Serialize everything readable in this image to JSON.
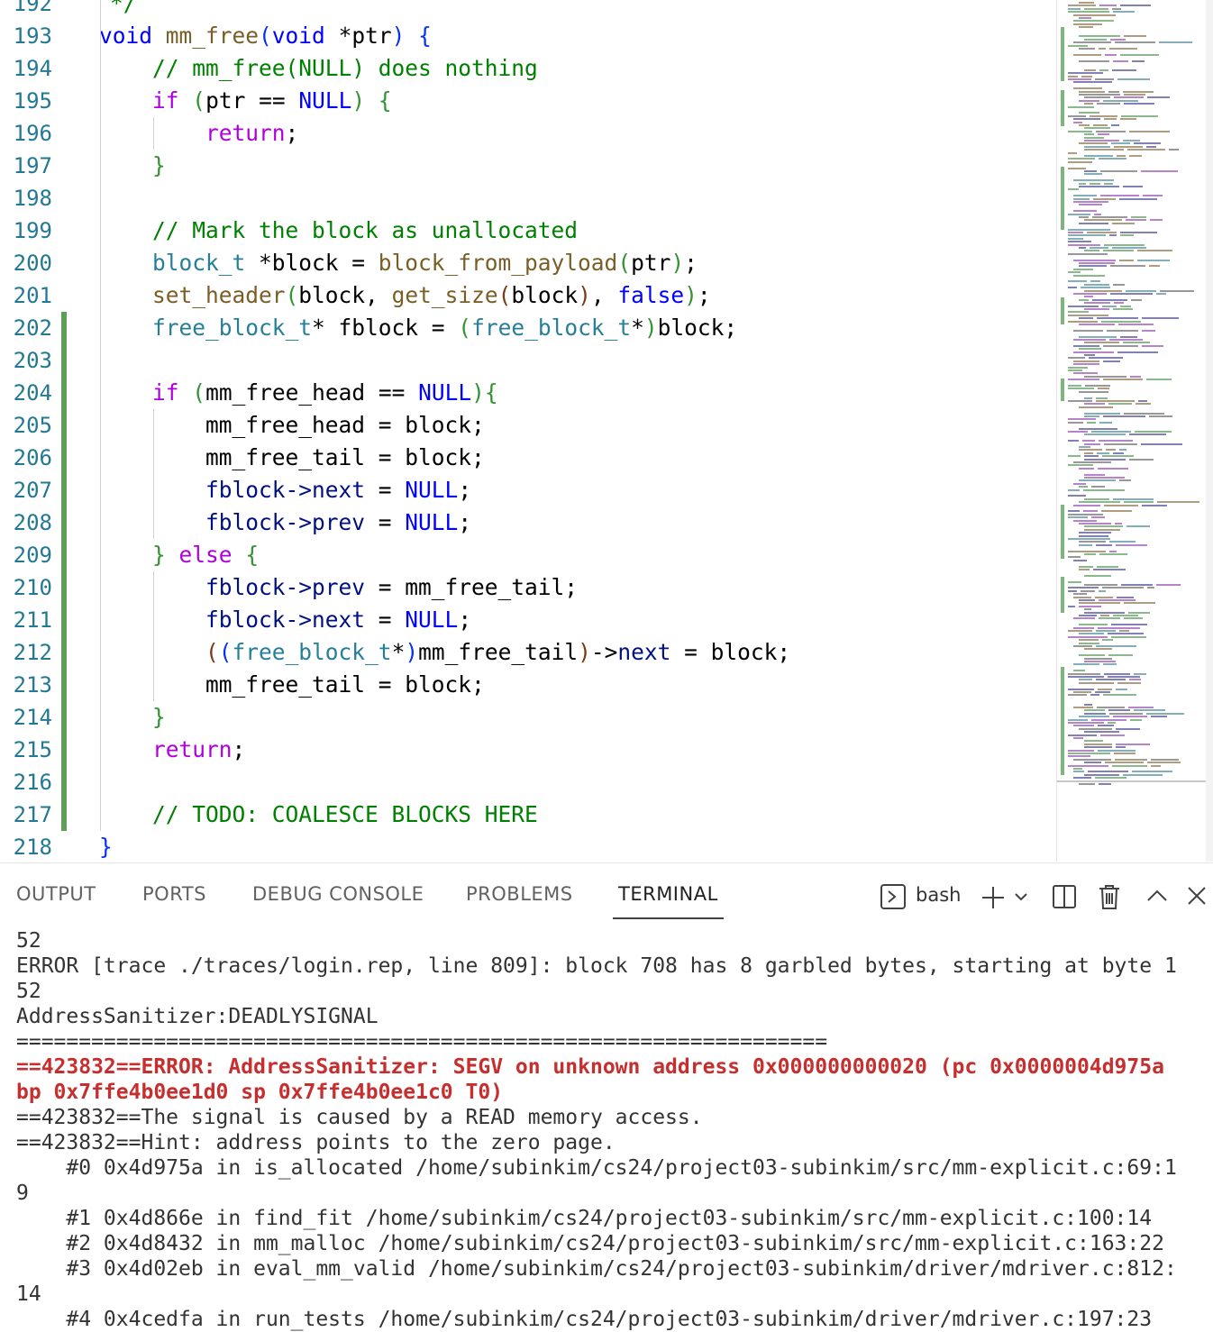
{
  "editor": {
    "partial_top_line": {
      "number": "192",
      "text": "*/"
    },
    "lines": [
      {
        "n": "193",
        "tokens": [
          [
            "kw",
            "void"
          ],
          [
            "",
            ""
          ],
          [
            "fn",
            " mm_free"
          ],
          [
            "p1",
            "("
          ],
          [
            "kw",
            "void"
          ],
          [
            "",
            " *ptr"
          ],
          [
            "p1",
            ")"
          ],
          [
            "",
            " "
          ],
          [
            "p1",
            "{"
          ]
        ]
      },
      {
        "n": "194",
        "tokens": [
          [
            "",
            "    "
          ],
          [
            "cm",
            "// mm_free(NULL) does nothing"
          ]
        ]
      },
      {
        "n": "195",
        "tokens": [
          [
            "",
            "    "
          ],
          [
            "ctl",
            "if"
          ],
          [
            "",
            " "
          ],
          [
            "p2",
            "("
          ],
          [
            "",
            "ptr == "
          ],
          [
            "nl",
            "NULL"
          ],
          [
            "p2",
            ")"
          ],
          [
            "",
            " "
          ],
          [
            "p2",
            "{"
          ]
        ]
      },
      {
        "n": "196",
        "tokens": [
          [
            "",
            "        "
          ],
          [
            "ctl",
            "return"
          ],
          [
            "",
            ";"
          ]
        ]
      },
      {
        "n": "197",
        "tokens": [
          [
            "",
            "    "
          ],
          [
            "p2",
            "}"
          ]
        ]
      },
      {
        "n": "198",
        "tokens": []
      },
      {
        "n": "199",
        "tokens": [
          [
            "",
            "    "
          ],
          [
            "cm",
            "// Mark the block as unallocated"
          ]
        ]
      },
      {
        "n": "200",
        "tokens": [
          [
            "",
            "    "
          ],
          [
            "ty",
            "block_t"
          ],
          [
            "",
            " *block = "
          ],
          [
            "fn",
            "block_from_payload"
          ],
          [
            "p2",
            "("
          ],
          [
            "",
            "ptr"
          ],
          [
            "p2",
            ")"
          ],
          [
            "",
            ";"
          ]
        ]
      },
      {
        "n": "201",
        "tokens": [
          [
            "",
            "    "
          ],
          [
            "fn",
            "set_header"
          ],
          [
            "p2",
            "("
          ],
          [
            "",
            "block, "
          ],
          [
            "fn",
            "get_size"
          ],
          [
            "p3",
            "("
          ],
          [
            "",
            "block"
          ],
          [
            "p3",
            ")"
          ],
          [
            "",
            ", "
          ],
          [
            "kw",
            "false"
          ],
          [
            "p2",
            ")"
          ],
          [
            "",
            ";"
          ]
        ]
      },
      {
        "n": "202",
        "tokens": [
          [
            "",
            "    "
          ],
          [
            "ty",
            "free_block_t"
          ],
          [
            "",
            "* fblock = "
          ],
          [
            "p2",
            "("
          ],
          [
            "ty",
            "free_block_t"
          ],
          [
            "",
            "*"
          ],
          [
            "p2",
            ")"
          ],
          [
            "",
            "block;"
          ]
        ]
      },
      {
        "n": "203",
        "tokens": []
      },
      {
        "n": "204",
        "tokens": [
          [
            "",
            "    "
          ],
          [
            "ctl",
            "if"
          ],
          [
            "",
            " "
          ],
          [
            "p2",
            "("
          ],
          [
            "",
            "mm_free_head == "
          ],
          [
            "nl",
            "NULL"
          ],
          [
            "p2",
            ")"
          ],
          [
            "p2",
            "{"
          ]
        ]
      },
      {
        "n": "205",
        "tokens": [
          [
            "",
            "        mm_free_head = block;"
          ]
        ]
      },
      {
        "n": "206",
        "tokens": [
          [
            "",
            "        mm_free_tail = block;"
          ]
        ]
      },
      {
        "n": "207",
        "tokens": [
          [
            "",
            "        "
          ],
          [
            "pr",
            "fblock->next"
          ],
          [
            "",
            " = "
          ],
          [
            "nl",
            "NULL"
          ],
          [
            "",
            ";"
          ]
        ]
      },
      {
        "n": "208",
        "tokens": [
          [
            "",
            "        "
          ],
          [
            "pr",
            "fblock->prev"
          ],
          [
            "",
            " = "
          ],
          [
            "nl",
            "NULL"
          ],
          [
            "",
            ";"
          ]
        ]
      },
      {
        "n": "209",
        "tokens": [
          [
            "",
            "    "
          ],
          [
            "p2",
            "}"
          ],
          [
            "",
            " "
          ],
          [
            "ctl",
            "else"
          ],
          [
            "",
            " "
          ],
          [
            "p2",
            "{"
          ]
        ]
      },
      {
        "n": "210",
        "tokens": [
          [
            "",
            "        "
          ],
          [
            "pr",
            "fblock->prev"
          ],
          [
            "",
            " = mm_free_tail;"
          ]
        ]
      },
      {
        "n": "211",
        "tokens": [
          [
            "",
            "        "
          ],
          [
            "pr",
            "fblock->next"
          ],
          [
            "",
            " = "
          ],
          [
            "nl",
            "NULL"
          ],
          [
            "",
            ";"
          ]
        ]
      },
      {
        "n": "212",
        "tokens": [
          [
            "",
            "        "
          ],
          [
            "p3",
            "("
          ],
          [
            "p1",
            "("
          ],
          [
            "ty",
            "free_block_t"
          ],
          [
            "",
            "*"
          ],
          [
            "p1",
            ")"
          ],
          [
            "",
            "mm_free_tail"
          ],
          [
            "p3",
            ")"
          ],
          [
            "",
            "->"
          ],
          [
            "pr",
            "next"
          ],
          [
            "",
            " = block;"
          ]
        ]
      },
      {
        "n": "213",
        "tokens": [
          [
            "",
            "        mm_free_tail = block;"
          ]
        ]
      },
      {
        "n": "214",
        "tokens": [
          [
            "",
            "    "
          ],
          [
            "p2",
            "}"
          ]
        ]
      },
      {
        "n": "215",
        "tokens": [
          [
            "",
            "    "
          ],
          [
            "ctl",
            "return"
          ],
          [
            "",
            ";"
          ]
        ]
      },
      {
        "n": "216",
        "tokens": []
      },
      {
        "n": "217",
        "tokens": [
          [
            "",
            "    "
          ],
          [
            "cm",
            "// TODO: COALESCE BLOCKS HERE"
          ]
        ]
      },
      {
        "n": "218",
        "tokens": [
          [
            "p1",
            "}"
          ]
        ]
      }
    ],
    "changed_lines": [
      "202",
      "203",
      "204",
      "205",
      "206",
      "207",
      "208",
      "209",
      "210",
      "211",
      "212",
      "213",
      "214",
      "215",
      "216",
      "217"
    ]
  },
  "panel": {
    "tabs": [
      {
        "label": "OUTPUT",
        "active": false
      },
      {
        "label": "PORTS",
        "active": false
      },
      {
        "label": "DEBUG CONSOLE",
        "active": false
      },
      {
        "label": "PROBLEMS",
        "active": false
      },
      {
        "label": "TERMINAL",
        "active": true
      }
    ],
    "shell_label": "bash",
    "icons": [
      "terminal-icon",
      "add-icon",
      "chevron-down-icon",
      "split-icon",
      "trash-icon",
      "chevron-up-icon",
      "close-icon"
    ]
  },
  "terminal": {
    "lines": [
      {
        "t": "52",
        "err": false
      },
      {
        "t": "ERROR [trace ./traces/login.rep, line 809]: block 708 has 8 garbled bytes, starting at byte 1",
        "err": false
      },
      {
        "t": "52",
        "err": false
      },
      {
        "t": "AddressSanitizer:DEADLYSIGNAL",
        "err": false
      },
      {
        "t": "=================================================================",
        "err": false
      },
      {
        "t": "==423832==ERROR: AddressSanitizer: SEGV on unknown address 0x000000000020 (pc 0x0000004d975a",
        "err": true
      },
      {
        "t": "bp 0x7ffe4b0ee1d0 sp 0x7ffe4b0ee1c0 T0)",
        "err": true
      },
      {
        "t": "==423832==The signal is caused by a READ memory access.",
        "err": false
      },
      {
        "t": "==423832==Hint: address points to the zero page.",
        "err": false
      },
      {
        "t": "    #0 0x4d975a in is_allocated /home/subinkim/cs24/project03-subinkim/src/mm-explicit.c:69:1",
        "err": false
      },
      {
        "t": "9",
        "err": false
      },
      {
        "t": "    #1 0x4d866e in find_fit /home/subinkim/cs24/project03-subinkim/src/mm-explicit.c:100:14",
        "err": false
      },
      {
        "t": "    #2 0x4d8432 in mm_malloc /home/subinkim/cs24/project03-subinkim/src/mm-explicit.c:163:22",
        "err": false
      },
      {
        "t": "    #3 0x4d02eb in eval_mm_valid /home/subinkim/cs24/project03-subinkim/driver/mdriver.c:812:",
        "err": false
      },
      {
        "t": "14",
        "err": false
      },
      {
        "t": "    #4 0x4cedfa in run_tests /home/subinkim/cs24/project03-subinkim/driver/mdriver.c:197:23",
        "err": false
      }
    ]
  }
}
